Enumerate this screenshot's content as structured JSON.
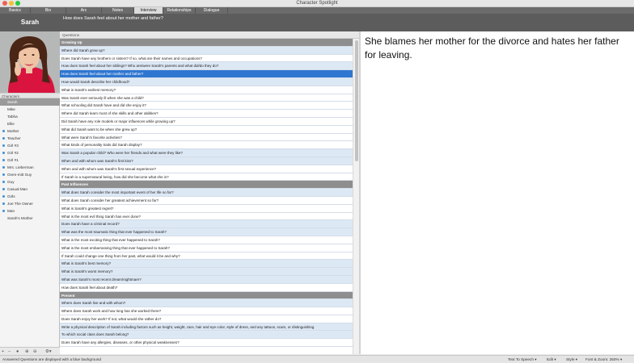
{
  "window": {
    "title": "Character Spotlight"
  },
  "tabs": [
    {
      "label": "Basics"
    },
    {
      "label": "Bio"
    },
    {
      "label": "Arc"
    },
    {
      "label": "Notes"
    },
    {
      "label": "Interview"
    },
    {
      "label": "Relationships"
    },
    {
      "label": "Dialogue"
    }
  ],
  "active_tab": "Interview",
  "header": {
    "character_name": "Sarah",
    "current_question": "How does Sarah feel about her mother and father?"
  },
  "sidebar": {
    "characters_label": "Characters",
    "characters": [
      {
        "name": "Sarah",
        "selected": true,
        "marked": false
      },
      {
        "name": "Mike",
        "selected": false,
        "marked": false
      },
      {
        "name": "Tabha",
        "selected": false,
        "marked": false
      },
      {
        "name": "Ellie",
        "selected": false,
        "marked": false
      },
      {
        "name": "Mother",
        "selected": false,
        "marked": true
      },
      {
        "name": "Teacher",
        "selected": false,
        "marked": true
      },
      {
        "name": "Girl #3",
        "selected": false,
        "marked": true
      },
      {
        "name": "Girl #2",
        "selected": false,
        "marked": true
      },
      {
        "name": "Girl #1",
        "selected": false,
        "marked": true
      },
      {
        "name": "Mrs. Lieberman",
        "selected": false,
        "marked": true
      },
      {
        "name": "Oven-mitt Guy",
        "selected": false,
        "marked": true
      },
      {
        "name": "Guy",
        "selected": false,
        "marked": true
      },
      {
        "name": "Casual Man",
        "selected": false,
        "marked": true
      },
      {
        "name": "Girls",
        "selected": false,
        "marked": true
      },
      {
        "name": "Joe The Owner",
        "selected": false,
        "marked": true
      },
      {
        "name": "Man",
        "selected": false,
        "marked": true
      },
      {
        "name": "Sarah's Mother",
        "selected": false,
        "marked": false
      }
    ],
    "toolbar": {
      "add_icon": "plus-icon",
      "remove_icon": "minus-icon",
      "person_icon": "person-icon",
      "zoom_in_icon": "zoom-in-icon",
      "zoom_out_icon": "zoom-out-icon",
      "gear_icon": "gear-icon"
    }
  },
  "questions": {
    "column_label": "Questions",
    "rows": [
      {
        "text": "Growing Up",
        "kind": "section"
      },
      {
        "text": "Where did Sarah grow up?",
        "kind": "answered"
      },
      {
        "text": "Does Sarah have any brothers or sisters?  If so, what are their names and occupations?",
        "kind": "plain"
      },
      {
        "text": "How does Sarah feel about her siblings?  Who are/were Sarah's parents and what did/do they do?",
        "kind": "answered"
      },
      {
        "text": "How does Sarah feel about her mother and father?",
        "kind": "selected"
      },
      {
        "text": "How would Sarah describe her childhood?",
        "kind": "answered"
      },
      {
        "text": "What is Sarah's earliest memory?",
        "kind": "plain"
      },
      {
        "text": "Was Sarah ever seriously ill when she was a child?",
        "kind": "plain"
      },
      {
        "text": "What schooling did Sarah have and did she enjoy it?",
        "kind": "plain"
      },
      {
        "text": "Where did Sarah learn most of she skills and other abilities?",
        "kind": "plain"
      },
      {
        "text": "Did Sarah have any role models or major influences while growing up?",
        "kind": "plain"
      },
      {
        "text": "What did Sarah want to be when she grew up?",
        "kind": "plain"
      },
      {
        "text": "What were Sarah's favorite activities?",
        "kind": "plain"
      },
      {
        "text": "What kinds of personality traits did Sarah display?",
        "kind": "plain"
      },
      {
        "text": "Was Sarah a popular child?  Who were her friends and what were they like?",
        "kind": "answered"
      },
      {
        "text": "When and with whom was Sarah's first kiss?",
        "kind": "answered"
      },
      {
        "text": "When and with whom was Sarah's first sexual experience?",
        "kind": "plain"
      },
      {
        "text": "If Sarah is a supernatural being, how did she become what she is?",
        "kind": "plain"
      },
      {
        "text": "Past Influences",
        "kind": "section"
      },
      {
        "text": "What does Sarah consider the most important event of her life so far?",
        "kind": "answered"
      },
      {
        "text": "What does Sarah consider her greatest achievement so far?",
        "kind": "plain"
      },
      {
        "text": "What is Sarah's greatest regret?",
        "kind": "plain"
      },
      {
        "text": "What is the most evil thing Sarah has ever done?",
        "kind": "plain"
      },
      {
        "text": "Does Sarah have a criminal record?",
        "kind": "answered"
      },
      {
        "text": "What was the most traumatic thing that ever happened to Sarah?",
        "kind": "answered"
      },
      {
        "text": "What is the most exciting thing that ever happened to Sarah?",
        "kind": "plain"
      },
      {
        "text": "What is the most embarrassing thing that ever happened to Sarah?",
        "kind": "plain"
      },
      {
        "text": "If Sarah could change one thing from her past, what would it be and why?",
        "kind": "plain"
      },
      {
        "text": "What is Sarah's best memory?",
        "kind": "answered"
      },
      {
        "text": "What is Sarah's worst memory?",
        "kind": "answered"
      },
      {
        "text": "What was Sarah's most recent dream/nightmare?",
        "kind": "answered"
      },
      {
        "text": "How does Sarah feel about death?",
        "kind": "plain"
      },
      {
        "text": "Present",
        "kind": "section"
      },
      {
        "text": "Where does Sarah live and with whom?",
        "kind": "answered"
      },
      {
        "text": "Where does Sarah work and how long has she worked there?",
        "kind": "plain"
      },
      {
        "text": "Does Sarah enjoy her work?  If not, what would she rather do?",
        "kind": "plain"
      },
      {
        "text": "Write a physical description of Sarah including factors such as height, weight, race, hair and eye color, style of dress, and any tattoos, scars, or distinguishing",
        "kind": "answered"
      },
      {
        "text": "To which social class does Sarah belong?",
        "kind": "answered"
      },
      {
        "text": "Does Sarah have any allergies, diseases, or other physical weaknesses?",
        "kind": "plain"
      }
    ]
  },
  "answer": {
    "text": "She blames her mother for the divorce and hates her father for leaving."
  },
  "statusbar": {
    "hint": "Answered Questions are displayed with a blue background",
    "text_to_speech": "Text To Speech",
    "edit": "Edit",
    "style": "Style",
    "font_zoom": "Font & Zoom: 250%"
  },
  "colors": {
    "section": "#8e8e8e",
    "answered": "#dde8f5",
    "selected": "#2f76d0",
    "character_marker": "#3e8fd3"
  }
}
